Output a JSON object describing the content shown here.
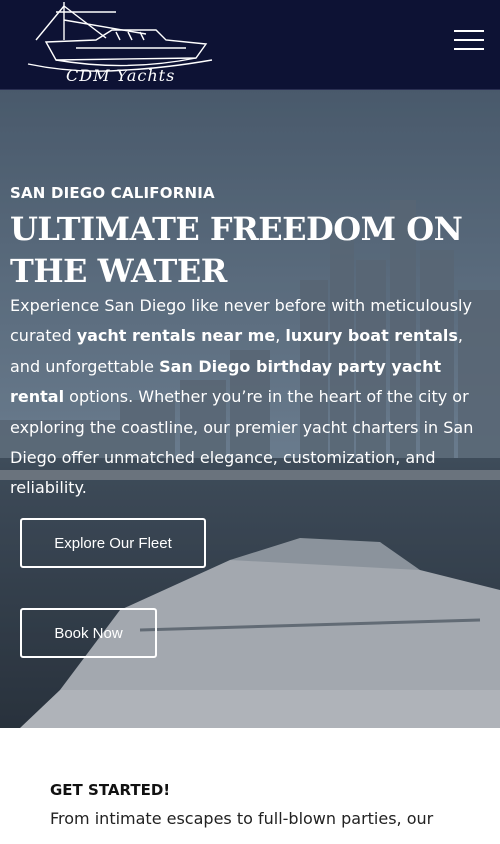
{
  "header": {
    "logo_text": "CDM Yachts",
    "menu_icon": "hamburger-menu-icon",
    "background": "#0d1234"
  },
  "hero": {
    "eyebrow": "SAN DIEGO CALIFORNIA",
    "headline": "ULTIMATE FREEDOM ON THE WATER",
    "intro": {
      "part1": "Experience San Diego like never before with meticulously curated ",
      "bold1": "yacht rentals near me",
      "part2": ", ",
      "bold2": "luxury boat rentals",
      "part3": ", and unforgettable ",
      "bold3": "San Diego birthday party yacht rental",
      "part4": " options. Whether you’re in the heart of the city or exploring the coastline, our premier yacht charters in San Diego offer unmatched elegance, customization, and reliability."
    },
    "buttons": {
      "fleet_label": "Explore Our Fleet",
      "book_label": "Book Now"
    }
  },
  "get_started": {
    "heading": "GET STARTED!",
    "text": "From intimate escapes to full-blown parties, our"
  }
}
